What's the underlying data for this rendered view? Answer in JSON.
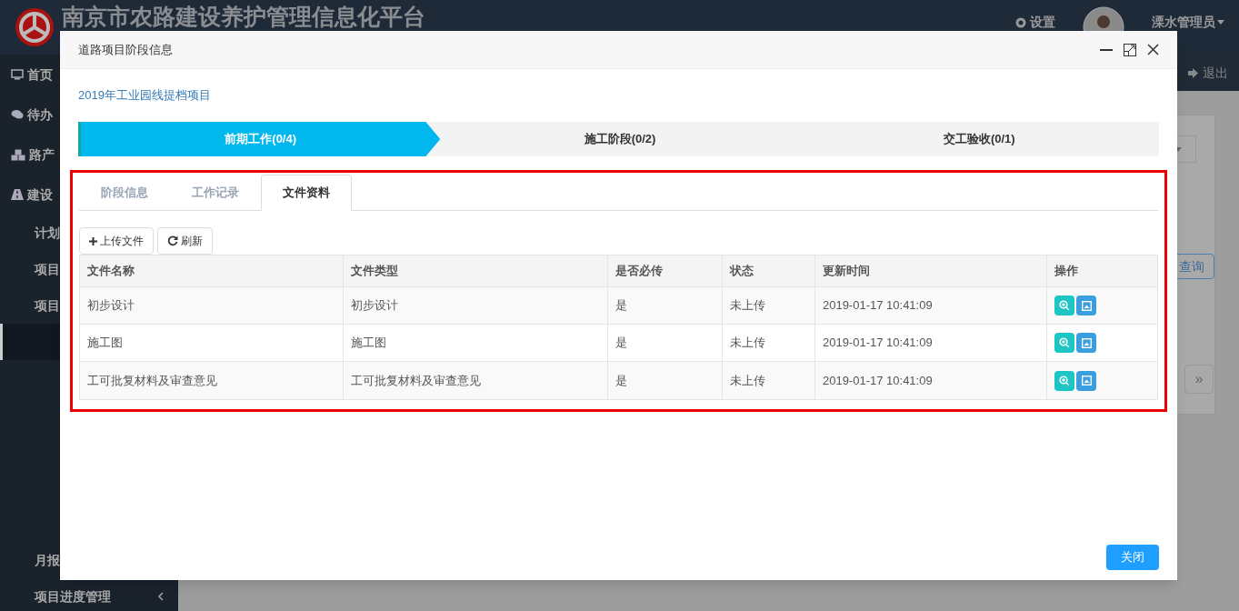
{
  "header": {
    "title": "南京市农路建设养护管理信息化平台",
    "settings": "设置",
    "user": "溧水管理员",
    "logout": "退出"
  },
  "sidebar": {
    "items": [
      {
        "label": "首页"
      },
      {
        "label": "待办"
      },
      {
        "label": "路产"
      },
      {
        "label": "建设",
        "children": [
          {
            "label": "计划"
          },
          {
            "label": "项目"
          },
          {
            "label": "项目",
            "children": [
              {
                "selected": true
              }
            ]
          },
          {
            "label": "月报"
          },
          {
            "label": "项目进度管理"
          }
        ]
      }
    ]
  },
  "background": {
    "query_button": "查询",
    "pager_next": "»"
  },
  "dialog": {
    "title": "道路项目阶段信息",
    "project_link": "2019年工业园线提档项目",
    "steps": [
      {
        "label": "前期工作(0/4)",
        "selected": true
      },
      {
        "label": "施工阶段(0/2)",
        "selected": false
      },
      {
        "label": "交工验收(0/1)",
        "selected": false
      }
    ],
    "tabs": [
      {
        "label": "阶段信息",
        "selected": false
      },
      {
        "label": "工作记录",
        "selected": false
      },
      {
        "label": "文件资料",
        "selected": true
      }
    ],
    "toolbar": [
      {
        "kind": "upload",
        "label": "上传文件"
      },
      {
        "kind": "refresh",
        "label": "刷新"
      }
    ],
    "table": {
      "columns": [
        "文件名称",
        "文件类型",
        "是否必传",
        "状态",
        "更新时间",
        "操作"
      ],
      "rows": [
        {
          "cells": [
            "初步设计",
            "初步设计",
            "是",
            "未上传",
            "2019-01-17 10:41:09"
          ]
        },
        {
          "cells": [
            "施工图",
            "施工图",
            "是",
            "未上传",
            "2019-01-17 10:41:09"
          ]
        },
        {
          "cells": [
            "工可批复材料及审查意见",
            "工可批复材料及审查意见",
            "是",
            "未上传",
            "2019-01-17 10:41:09"
          ]
        }
      ]
    },
    "close_button": "关闭"
  }
}
